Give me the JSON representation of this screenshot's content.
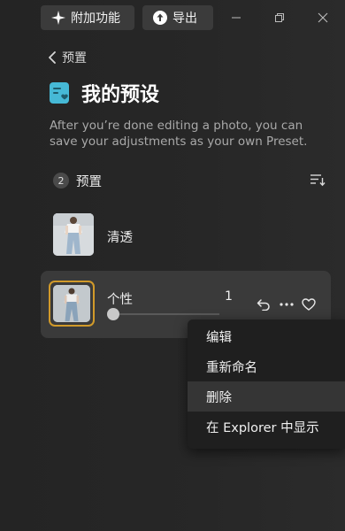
{
  "titlebar": {
    "addons_label": "附加功能",
    "export_label": "导出"
  },
  "breadcrumb": {
    "label": "预置"
  },
  "page": {
    "title": "我的预设",
    "description": "After you’re done editing a photo, you can save your adjustments as your own Preset."
  },
  "section": {
    "count": "2",
    "title": "预置"
  },
  "presets": [
    {
      "name": "清透"
    },
    {
      "name": "个性",
      "strength": "1",
      "slider_fraction": 0.0
    }
  ],
  "context_menu": {
    "items": [
      {
        "label": "编辑"
      },
      {
        "label": "重新命名"
      },
      {
        "label": "删除"
      },
      {
        "label": "在 Explorer 中显示"
      }
    ],
    "highlighted_index": 2
  },
  "colors": {
    "accent_frame": "#d19a2a",
    "title_icon": "#46b9d6",
    "background": "#262626"
  }
}
